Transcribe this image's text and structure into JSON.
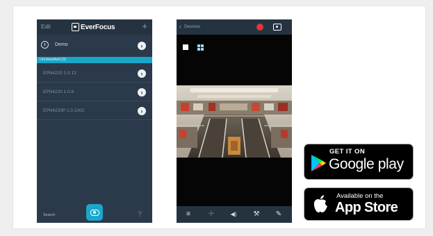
{
  "phone_list": {
    "header": {
      "edit_label": "Edit",
      "logo_text": "EverFocus",
      "add_glyph": "+"
    },
    "demo_row": {
      "label": "Demo",
      "icon": "clock-icon",
      "arrow_glyph": "›"
    },
    "section_label": "Unclassified (3)",
    "devices": [
      {
        "label": "EPN4220 1.0.13",
        "arrow_glyph": "›"
      },
      {
        "label": "EPN4220 1.0.6",
        "arrow_glyph": "›"
      },
      {
        "label": "EPN4220P 1.0.1002",
        "arrow_glyph": "›"
      }
    ],
    "footer": {
      "left_label": "Search",
      "center_icon": "camera-icon",
      "help_glyph": "?"
    }
  },
  "phone_viewer": {
    "header": {
      "back_glyph": "‹",
      "back_label": "Devices",
      "record_icon": "record-icon",
      "snapshot_icon": "snapshot-icon"
    },
    "layout_icons": [
      "single-view-icon",
      "quad-view-icon"
    ],
    "footer_icons": [
      {
        "name": "menu-icon",
        "glyph": "≡"
      },
      {
        "name": "ptz-icon",
        "glyph": "✛"
      },
      {
        "name": "audio-icon",
        "glyph": "◀)"
      },
      {
        "name": "settings-wrench-icon",
        "glyph": "⚒"
      },
      {
        "name": "edit-pen-icon",
        "glyph": "✎"
      }
    ]
  },
  "badges": {
    "google": {
      "small_text": "GET IT ON",
      "big_text": "Google play"
    },
    "apple": {
      "small_text": "Available on the",
      "big_text": "App Store"
    }
  },
  "colors": {
    "phone_bg": "#2b3a4a",
    "header_bg": "#253341",
    "accent_cyan": "#18a7c8",
    "record_red": "#e1363b"
  }
}
